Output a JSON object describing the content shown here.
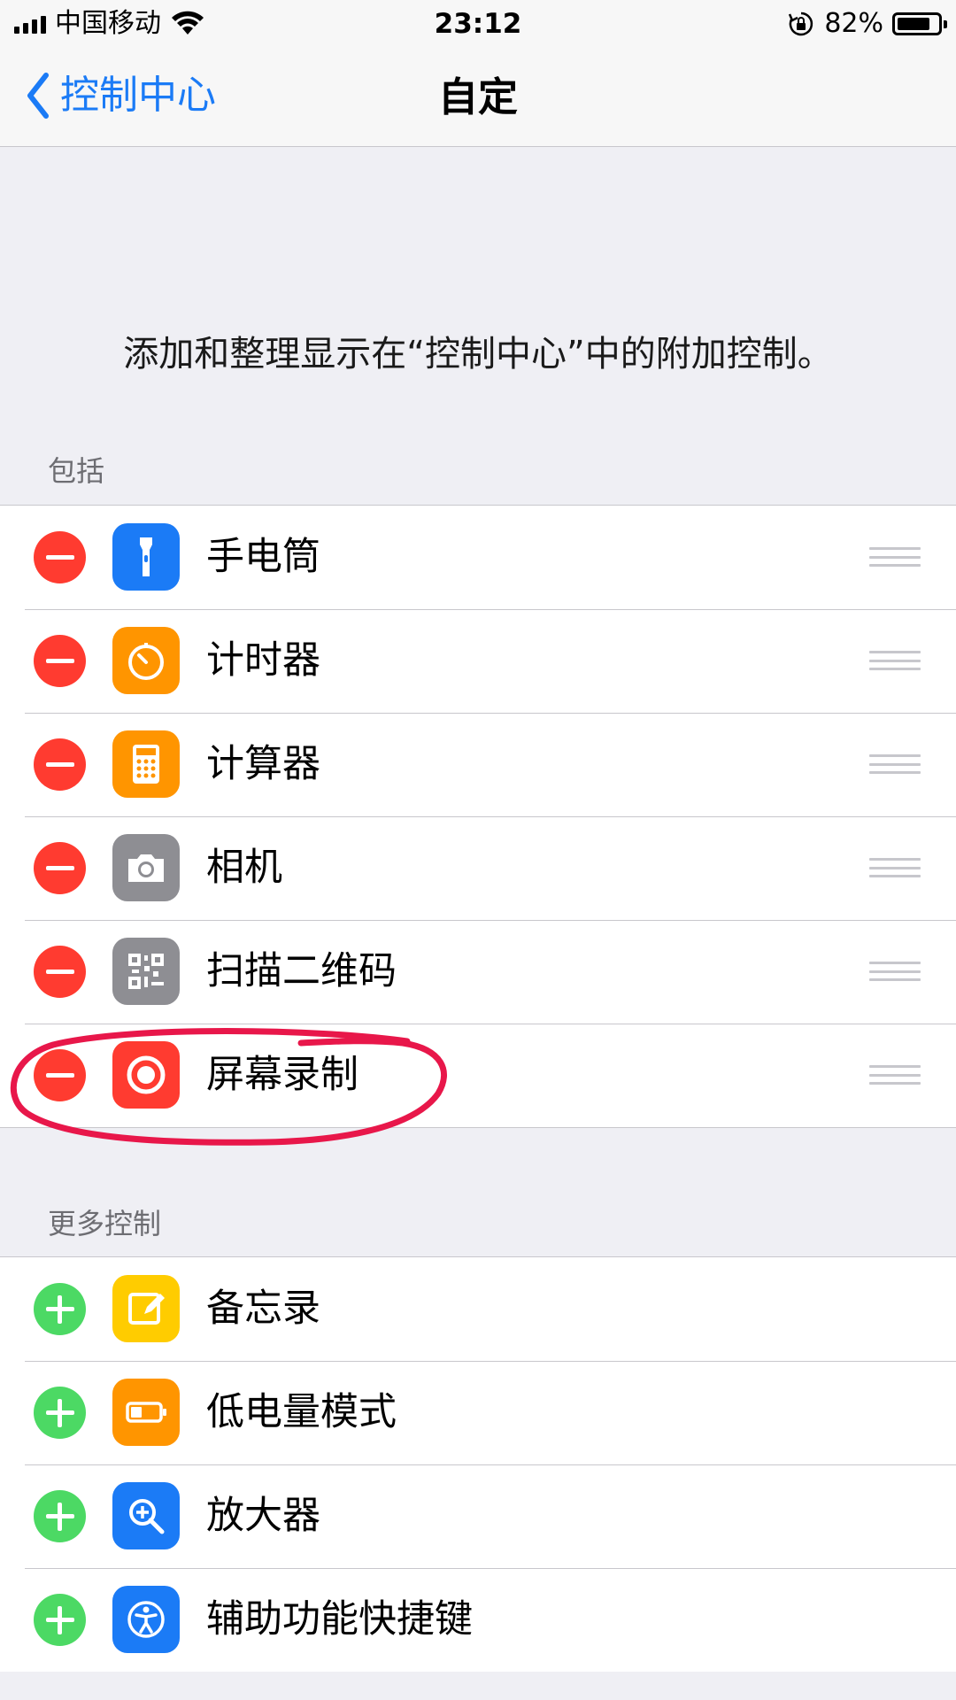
{
  "status_bar": {
    "carrier": "中国移动",
    "time": "23:12",
    "battery_percent": "82%",
    "battery_level": 0.82
  },
  "nav": {
    "back_label": "控制中心",
    "title": "自定"
  },
  "description": "添加和整理显示在“控制中心”中的附加控制。",
  "included": {
    "header": "包括",
    "items": [
      {
        "label": "手电筒",
        "icon": "flashlight-icon",
        "color": "#1b7bf6"
      },
      {
        "label": "计时器",
        "icon": "timer-icon",
        "color": "#ff9500"
      },
      {
        "label": "计算器",
        "icon": "calculator-icon",
        "color": "#ff9500"
      },
      {
        "label": "相机",
        "icon": "camera-icon",
        "color": "#8e8e93"
      },
      {
        "label": "扫描二维码",
        "icon": "qr-code-icon",
        "color": "#8e8e93"
      },
      {
        "label": "屏幕录制",
        "icon": "screen-record-icon",
        "color": "#ff3b30"
      }
    ]
  },
  "more": {
    "header": "更多控制",
    "items": [
      {
        "label": "备忘录",
        "icon": "notes-icon",
        "color": "#ffcc00"
      },
      {
        "label": "低电量模式",
        "icon": "low-power-battery-icon",
        "color": "#ff9500"
      },
      {
        "label": "放大器",
        "icon": "magnifier-icon",
        "color": "#1b7bf6"
      },
      {
        "label": "辅助功能快捷键",
        "icon": "accessibility-icon",
        "color": "#1b7bf6"
      }
    ]
  },
  "colors": {
    "remove": "#ff3b30",
    "add": "#4cd964",
    "link": "#1b7bf6",
    "annotation": "#e8174a"
  }
}
